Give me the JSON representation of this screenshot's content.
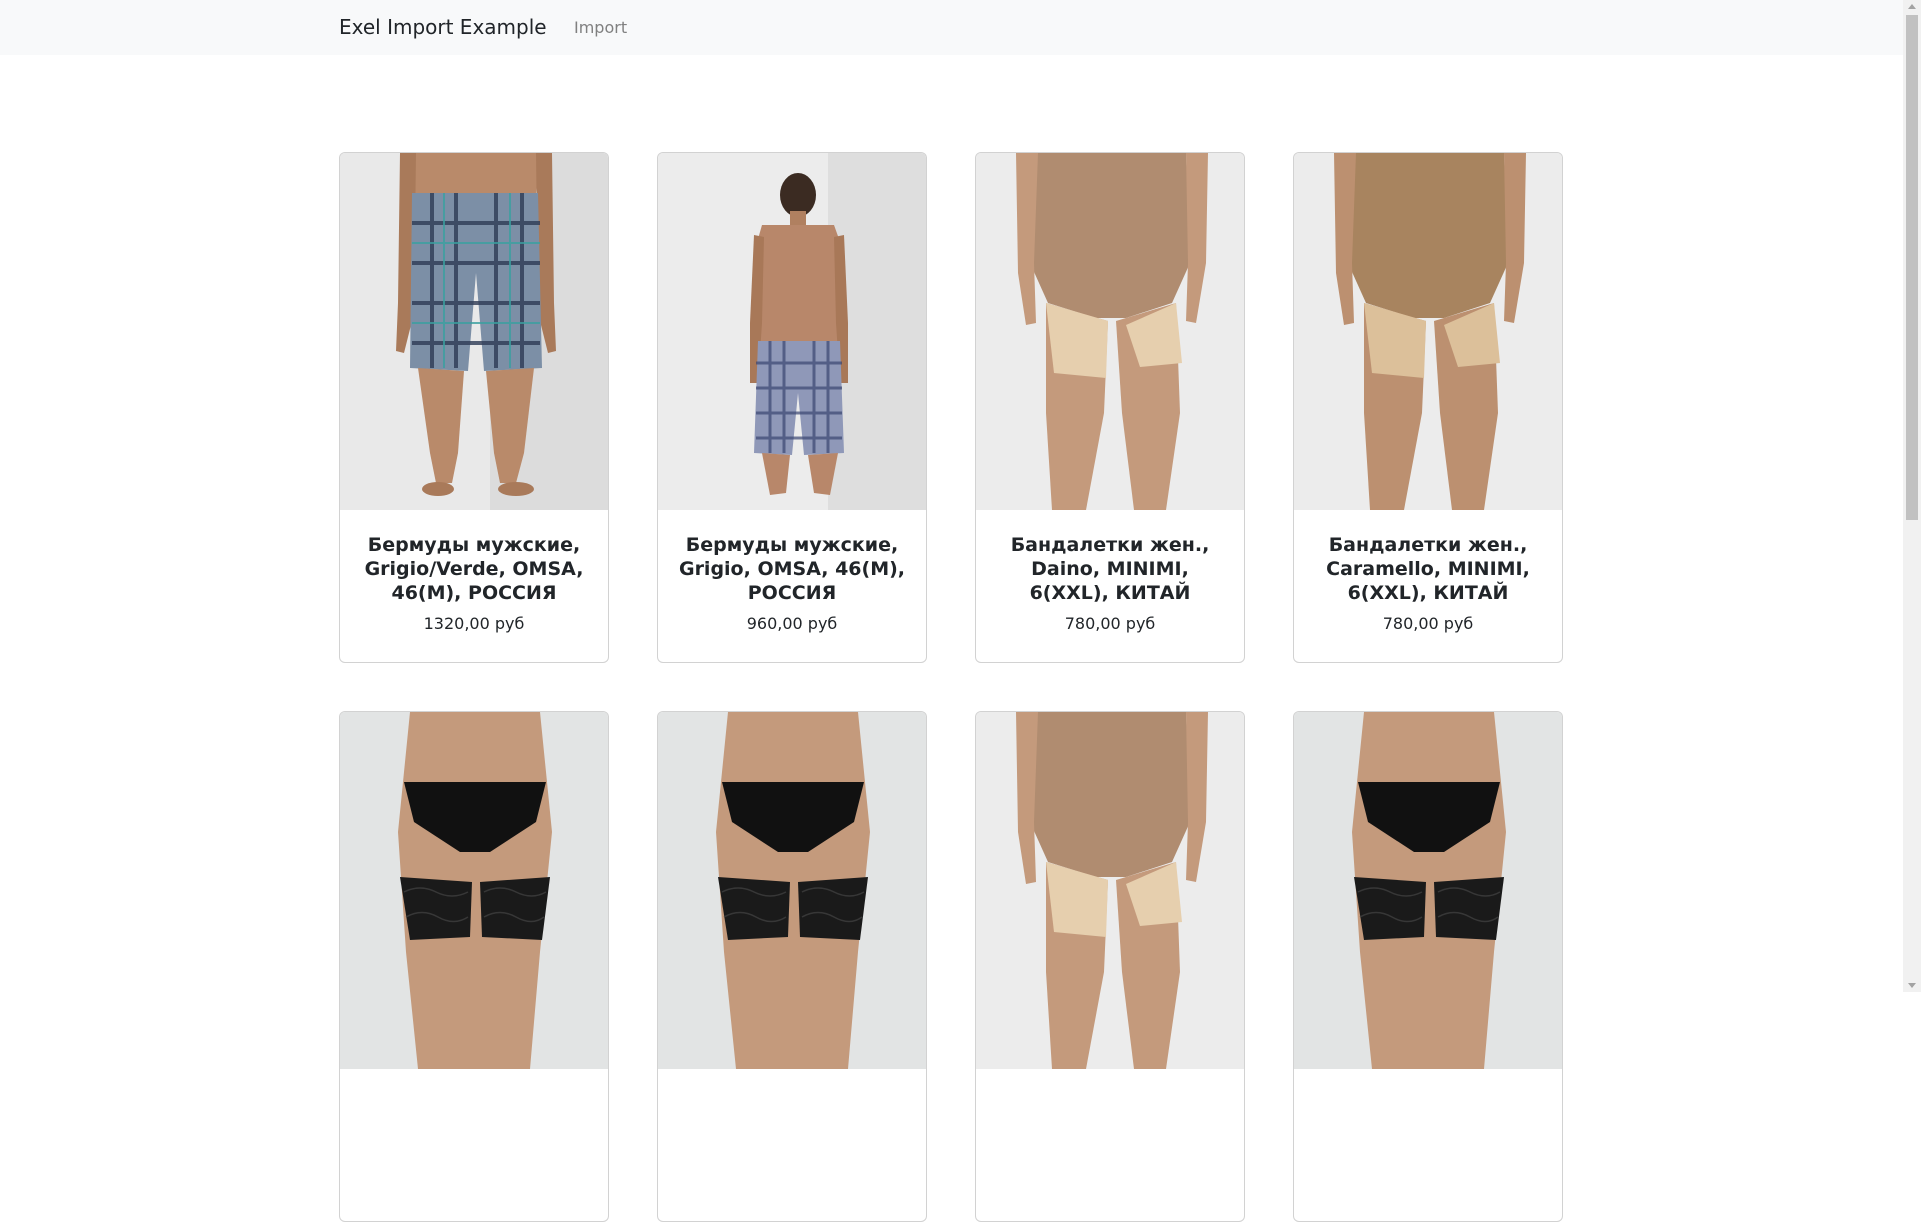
{
  "navbar": {
    "brand": "Exel Import Example",
    "links": [
      "Import"
    ]
  },
  "products": [
    {
      "title": "Бермуды мужские, Grigio/Verde, OMSA, 46(M), РОССИЯ",
      "price": "1320,00 руб",
      "image": "man-front-plaid-shorts"
    },
    {
      "title": "Бермуды мужские, Grigio, OMSA, 46(M), РОССИЯ",
      "price": "960,00 руб",
      "image": "man-back-plaid-shorts"
    },
    {
      "title": "Бандалетки жен., Daino, MINIMI, 6(XXL), КИТАЙ",
      "price": "780,00 руб",
      "image": "beige-thigh-bands"
    },
    {
      "title": "Бандалетки жен., Caramello, MINIMI, 6(XXL), КИТАЙ",
      "price": "780,00 руб",
      "image": "caramel-thigh-bands"
    },
    {
      "title": "",
      "price": "",
      "image": "black-lace-thigh-bands"
    },
    {
      "title": "",
      "price": "",
      "image": "black-lace-thigh-bands"
    },
    {
      "title": "",
      "price": "",
      "image": "beige-thigh-bands"
    },
    {
      "title": "",
      "price": "",
      "image": "black-lace-thigh-bands"
    }
  ],
  "colors": {
    "navbar_bg": "#f8f9fa",
    "text": "#212529",
    "muted_link": "#808080"
  }
}
